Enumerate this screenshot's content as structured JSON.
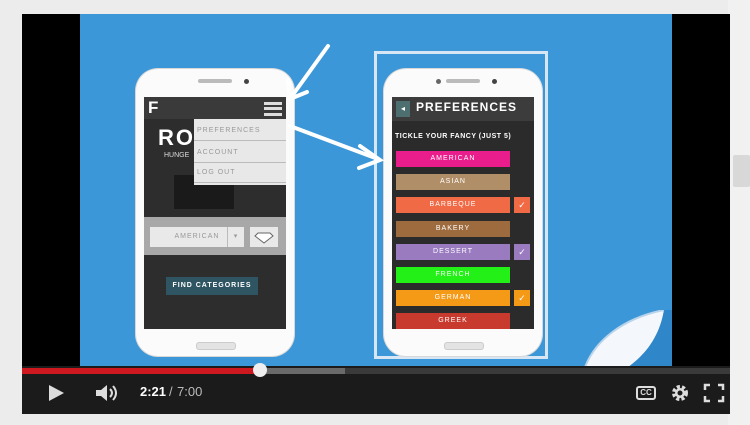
{
  "player": {
    "current_time": "2:21",
    "separator": "/",
    "duration": "7:00",
    "progress": 0.336,
    "buffered": 0.456,
    "controls": {
      "play_icon": "play-icon",
      "volume_icon": "volume-icon",
      "captions_label": "CC",
      "settings_icon": "gear-icon",
      "fullscreen_icon": "fullscreen-icon"
    },
    "colors": {
      "played": "#cc181e",
      "background": "#3b97d8"
    }
  },
  "left_phone": {
    "logo": "F",
    "brand": "RO",
    "tagline": "HUNGE",
    "menu": [
      "PREFERENCES",
      "ACCOUNT",
      "LOG OUT"
    ],
    "select_value": "AMERICAN",
    "find_button": "FIND CATEGORIES"
  },
  "right_phone": {
    "title": "PREFERENCES",
    "subtitle": "TICKLE YOUR FANCY (JUST 5)",
    "categories": [
      {
        "label": "AMERICAN",
        "color": "#e91d8c",
        "checked": false
      },
      {
        "label": "ASIAN",
        "color": "#b08e67",
        "checked": false
      },
      {
        "label": "BARBEQUE",
        "color": "#f06a45",
        "checked": true
      },
      {
        "label": "BAKERY",
        "color": "#9e6b3e",
        "checked": false
      },
      {
        "label": "DESSERT",
        "color": "#9a7bc0",
        "checked": true
      },
      {
        "label": "FRENCH",
        "color": "#22f017",
        "checked": false
      },
      {
        "label": "GERMAN",
        "color": "#f59a17",
        "checked": true
      },
      {
        "label": "GREEK",
        "color": "#c93a2e",
        "checked": false
      }
    ],
    "check_mark": "✓"
  }
}
